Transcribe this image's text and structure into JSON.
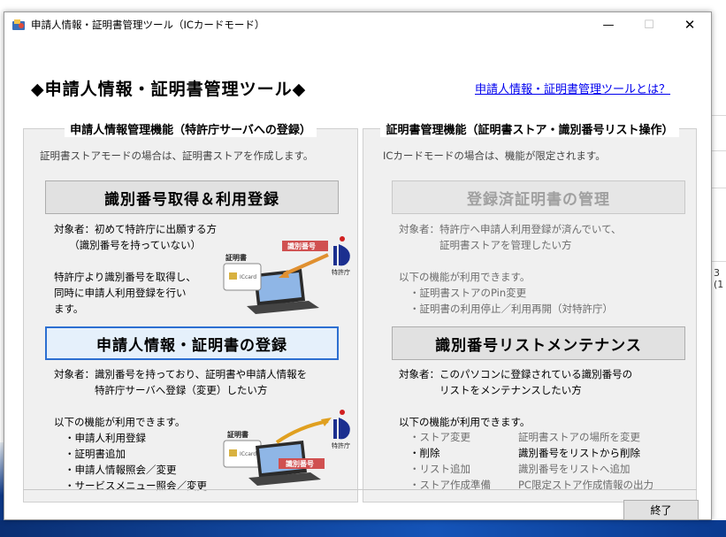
{
  "window": {
    "title": "申請人情報・証明書管理ツール（ICカードモード）",
    "minimize": "—",
    "maximize": "☐",
    "close": "✕"
  },
  "header": {
    "title": "◆申請人情報・証明書管理ツール◆",
    "help_link": "申請人情報・証明書管理ツールとは？"
  },
  "left_group": {
    "legend": "申請人情報管理機能（特許庁サーバへの登録）",
    "note": "証明書ストアモードの場合は、証明書ストアを作成します。",
    "button1": "識別番号取得＆利用登録",
    "button1_desc": [
      "対象者：初めて特許庁に出願する方",
      "　　（識別番号を持っていない）"
    ],
    "button1_detail": [
      "特許庁より識別番号を取得し、",
      "同時に申請人利用登録を行い",
      "ます。"
    ],
    "button2": "申請人情報・証明書の登録",
    "button2_desc": [
      "対象者：識別番号を持っており、証明書や申請人情報を",
      "　　　　特許庁サーバへ登録（変更）したい方"
    ],
    "features_title": "以下の機能が利用できます。",
    "features": [
      "・申請人利用登録",
      "・証明書追加",
      "・申請人情報照会／変更",
      "・サービスメニュー照会／変更"
    ],
    "illus_labels": {
      "cert": "証明書",
      "card": "ICcard",
      "id_no": "識別番号",
      "jpo": "特許庁"
    }
  },
  "right_group": {
    "legend": "証明書管理機能（証明書ストア・識別番号リスト操作）",
    "note": "ICカードモードの場合は、機能が限定されます。",
    "button1": "登録済証明書の管理",
    "button1_desc": [
      "対象者：特許庁へ申請人利用登録が済んでいて、",
      "　　　　証明書ストアを管理したい方"
    ],
    "button1_features_title": "以下の機能が利用できます。",
    "button1_features": [
      "・証明書ストアのPin変更",
      "・証明書の利用停止／利用再開（対特許庁）"
    ],
    "button2": "識別番号リストメンテナンス",
    "button2_desc": [
      "対象者：このパソコンに登録されている識別番号の",
      "　　　　リストをメンテナンスしたい方"
    ],
    "features_title": "以下の機能が利用できます。",
    "features": [
      {
        "name": "・ストア変更",
        "desc": "証明書ストアの場所を変更",
        "enabled": false
      },
      {
        "name": "・削除",
        "desc": "識別番号をリストから削除",
        "enabled": true
      },
      {
        "name": "・リスト追加",
        "desc": "識別番号をリストへ追加",
        "enabled": false
      },
      {
        "name": "・ストア作成準備",
        "desc": "PC限定ストア作成情報の出力",
        "enabled": false
      }
    ]
  },
  "footer": {
    "exit_button": "終了"
  },
  "background": {
    "fragment": "3 (1"
  }
}
